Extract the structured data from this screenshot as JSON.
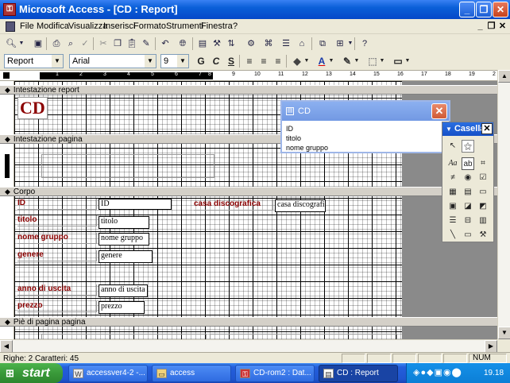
{
  "window": {
    "title": "Microsoft Access - [CD : Report]",
    "app_icon": "access-key-icon"
  },
  "menu": [
    "File",
    "Modifica",
    "Visualizza",
    "Inserisci",
    "Formato",
    "Strumenti",
    "Finestra",
    "?"
  ],
  "format_toolbar": {
    "object": "Report",
    "font": "Arial",
    "size": "9",
    "bold": "G",
    "italic": "C",
    "underline": "S"
  },
  "ruler": {
    "h_numbers": [
      "1",
      "2",
      "3",
      "4",
      "5",
      "6",
      "7",
      "8",
      "9",
      "10",
      "11",
      "12",
      "13",
      "14",
      "15",
      "16",
      "17",
      "18",
      "19",
      "2"
    ]
  },
  "sections": {
    "header": "Intestazione report",
    "page_header": "Intestazione pagina",
    "body": "Corpo",
    "page_footer": "Piè di pagina pagina"
  },
  "report_title": "CD",
  "fields": [
    {
      "label": "ID",
      "box": "ID"
    },
    {
      "label": "titolo",
      "box": "titolo"
    },
    {
      "label": "nome gruppo",
      "box": "nome gruppo"
    },
    {
      "label": "genere",
      "box": "genere"
    },
    {
      "label": "anno di uscita",
      "box": "anno di uscita"
    },
    {
      "label": "prezzo",
      "box": "prezzo"
    },
    {
      "label": "casa discografica",
      "box": "casa discografica"
    }
  ],
  "field_list": {
    "title": "CD",
    "items": [
      "ID",
      "titolo",
      "nome gruppo"
    ]
  },
  "toolbox": {
    "title": "Casella"
  },
  "status": {
    "left": "Righe: 2  Caratteri: 45",
    "num": "NUM"
  },
  "taskbar": {
    "start": "start",
    "tasks": [
      {
        "label": "accessver4-2 -...",
        "icon": "word-icon"
      },
      {
        "label": "access",
        "icon": "folder-icon"
      },
      {
        "label": "CD-rom2 : Dat...",
        "icon": "access-icon"
      },
      {
        "label": "CD : Report",
        "icon": "report-icon"
      }
    ],
    "clock": "19.18"
  }
}
